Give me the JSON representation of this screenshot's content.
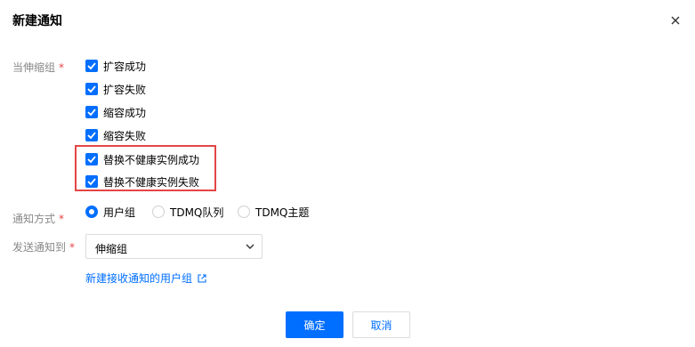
{
  "dialog": {
    "title": "新建通知"
  },
  "scaling_group": {
    "label": "当伸缩组",
    "required_mark": "*",
    "options": [
      {
        "label": "扩容成功",
        "checked": true
      },
      {
        "label": "扩容失败",
        "checked": true
      },
      {
        "label": "缩容成功",
        "checked": true
      },
      {
        "label": "缩容失败",
        "checked": true
      },
      {
        "label": "替换不健康实例成功",
        "checked": true
      },
      {
        "label": "替换不健康实例失败",
        "checked": true
      }
    ]
  },
  "notify_method": {
    "label": "通知方式",
    "required_mark": "*",
    "options": [
      {
        "label": "用户组",
        "selected": true
      },
      {
        "label": "TDMQ队列",
        "selected": false
      },
      {
        "label": "TDMQ主题",
        "selected": false
      }
    ]
  },
  "send_to": {
    "label": "发送通知到",
    "required_mark": "*",
    "value": "伸缩组"
  },
  "create_user_group_link": "新建接收通知的用户组",
  "buttons": {
    "confirm": "确定",
    "cancel": "取消"
  },
  "colors": {
    "accent": "#006eff",
    "required": "#e54545",
    "highlight_border": "#e54545"
  }
}
